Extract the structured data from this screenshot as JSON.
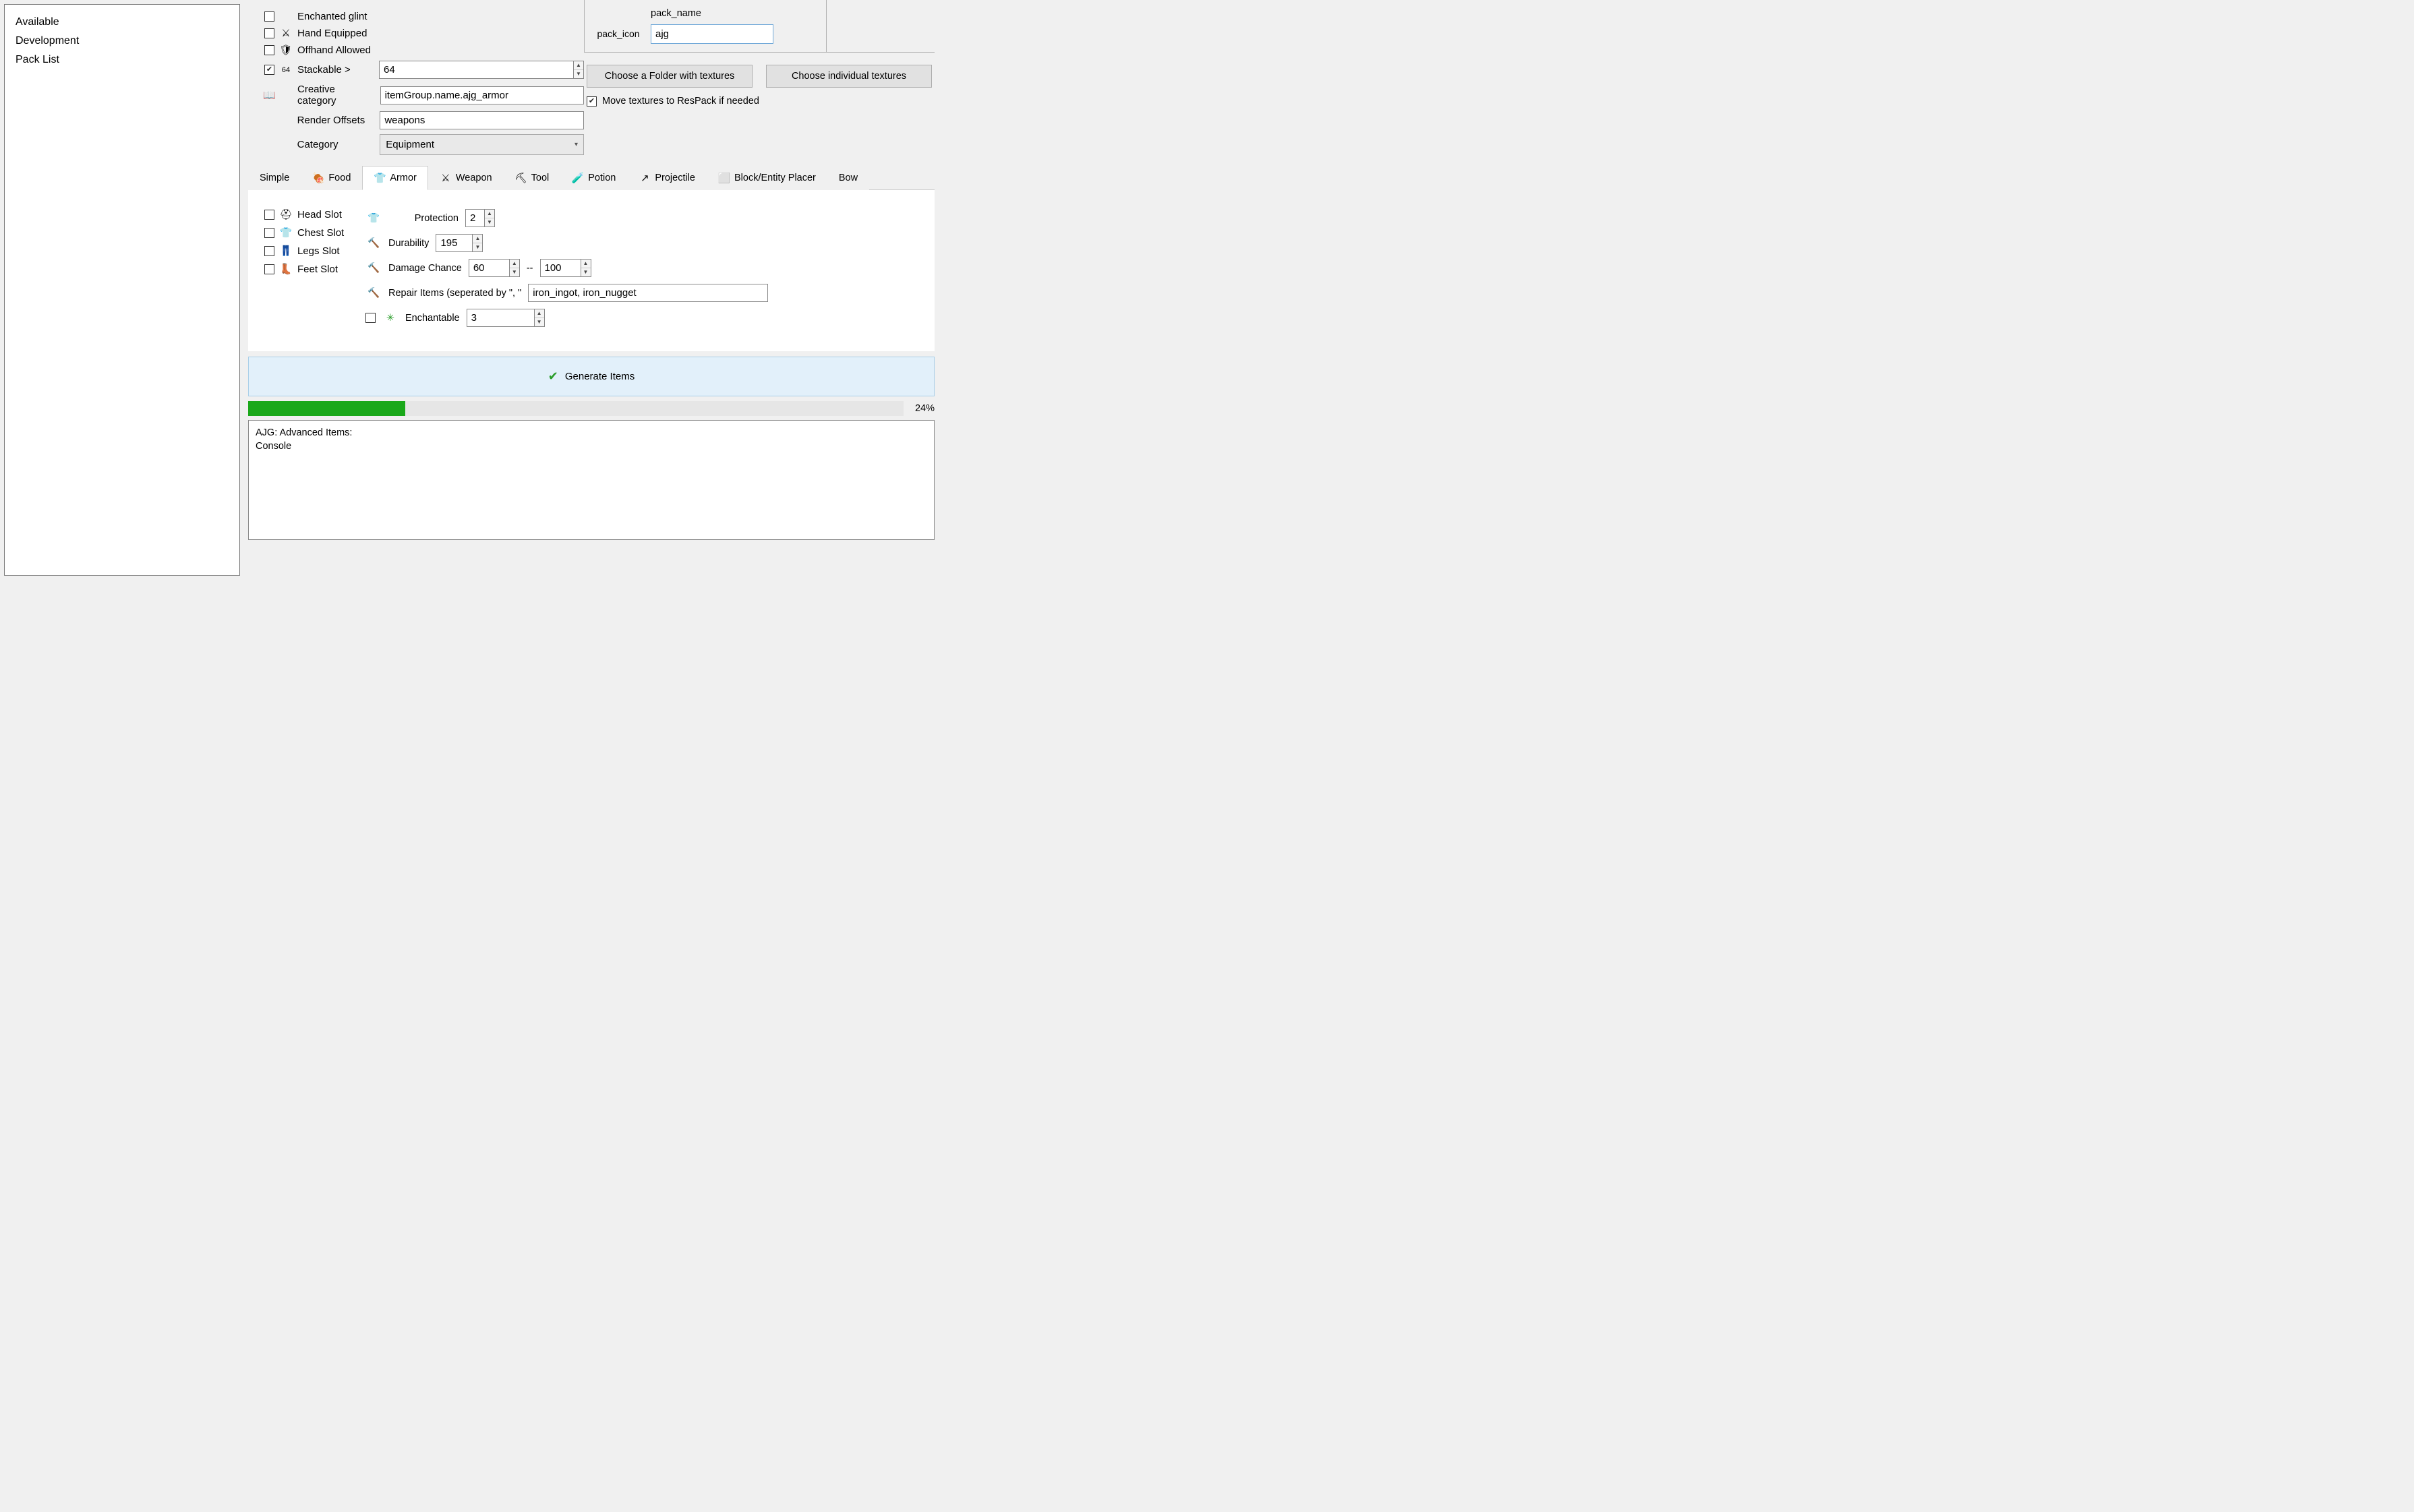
{
  "sidebar": {
    "items": [
      {
        "label": "Available"
      },
      {
        "label": "Development"
      },
      {
        "label": "Pack List"
      }
    ]
  },
  "props": {
    "enchanted_glint": {
      "label": "Enchanted glint",
      "checked": false
    },
    "hand_equipped": {
      "label": "Hand Equipped",
      "checked": false
    },
    "offhand_allowed": {
      "label": "Offhand Allowed",
      "checked": false
    },
    "stackable": {
      "label": "Stackable >",
      "checked": true,
      "value": "64"
    },
    "creative_category": {
      "label": "Creative category",
      "value": "itemGroup.name.ajg_armor"
    },
    "render_offsets": {
      "label": "Render Offsets",
      "value": "weapons"
    },
    "category": {
      "label": "Category",
      "value": "Equipment"
    }
  },
  "pack": {
    "icon_label": "pack_icon",
    "name_label": "pack_name",
    "name_value": "ajg"
  },
  "textures": {
    "folder_btn": "Choose a Folder with textures",
    "individual_btn": "Choose individual textures",
    "move_checkbox": {
      "label": "Move textures to ResPack if needed",
      "checked": true
    }
  },
  "tabs": [
    {
      "label": "Simple",
      "icon": ""
    },
    {
      "label": "Food",
      "icon": "🍖"
    },
    {
      "label": "Armor",
      "icon": "👕",
      "active": true
    },
    {
      "label": "Weapon",
      "icon": "⚔"
    },
    {
      "label": "Tool",
      "icon": "⛏"
    },
    {
      "label": "Potion",
      "icon": "🧪"
    },
    {
      "label": "Projectile",
      "icon": "↗"
    },
    {
      "label": "Block/Entity Placer",
      "icon": "⬜"
    },
    {
      "label": "Bow",
      "icon": ""
    }
  ],
  "armor": {
    "slots": {
      "head": {
        "label": "Head Slot",
        "checked": false
      },
      "chest": {
        "label": "Chest Slot",
        "checked": false
      },
      "legs": {
        "label": "Legs Slot",
        "checked": false
      },
      "feet": {
        "label": "Feet Slot",
        "checked": false
      }
    },
    "protection": {
      "label": "Protection",
      "value": "2"
    },
    "durability": {
      "label": "Durability",
      "value": "195"
    },
    "damage_chance": {
      "label": "Damage Chance",
      "min": "60",
      "sep": "--",
      "max": "100"
    },
    "repair_items": {
      "label": "Repair Items (seperated by \", \"",
      "value": "iron_ingot, iron_nugget"
    },
    "enchantable": {
      "label": "Enchantable",
      "checked": false,
      "value": "3"
    }
  },
  "generate_btn": "Generate Items",
  "progress": {
    "percent": 24,
    "label": "24%"
  },
  "console": {
    "line1": "AJG: Advanced Items:",
    "line2": "Console"
  }
}
